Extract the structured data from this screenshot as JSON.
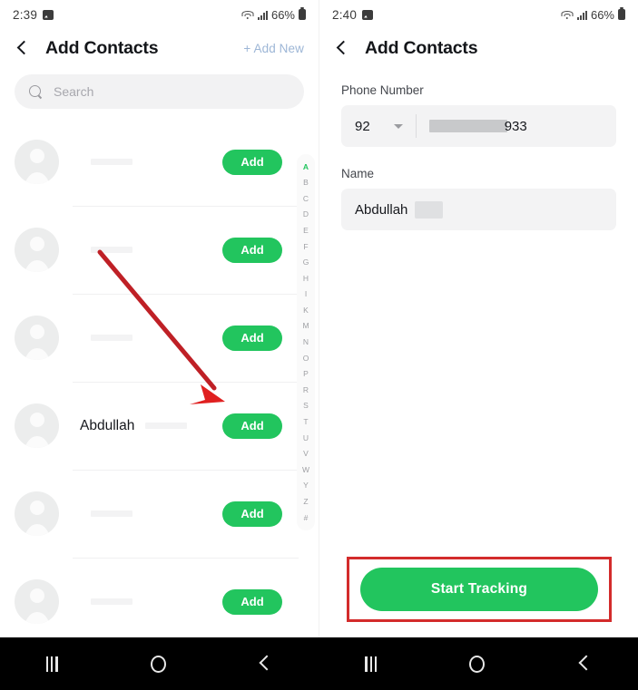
{
  "left_panel": {
    "status_bar": {
      "time": "2:39",
      "battery": "66%",
      "image_icon": "image-icon",
      "wifi_icon": "wifi-icon",
      "signal_icon": "signal-icon",
      "battery_icon": "battery-icon"
    },
    "appbar": {
      "back_icon": "back-chevron-icon",
      "title": "Add Contacts",
      "add_new_label": "+ Add New"
    },
    "search": {
      "icon": "search-icon",
      "placeholder": "Search",
      "value": ""
    },
    "contacts": [
      {
        "name": "",
        "add_label": "Add",
        "redacted": true
      },
      {
        "name": "",
        "add_label": "Add",
        "redacted": true
      },
      {
        "name": "",
        "add_label": "Add",
        "redacted": true
      },
      {
        "name": "Abdullah",
        "add_label": "Add",
        "redacted": true
      },
      {
        "name": "",
        "add_label": "Add",
        "redacted": true
      },
      {
        "name": "",
        "add_label": "Add",
        "redacted": true
      }
    ],
    "alpha_index": {
      "letters": [
        "A",
        "B",
        "C",
        "D",
        "E",
        "F",
        "G",
        "H",
        "I",
        "K",
        "M",
        "N",
        "O",
        "P",
        "R",
        "S",
        "T",
        "U",
        "V",
        "W",
        "Y",
        "Z",
        "#"
      ],
      "active": "A"
    },
    "annotation": {
      "type": "arrow",
      "color": "#bf2026",
      "points_to": "add-button-abdullah"
    }
  },
  "right_panel": {
    "status_bar": {
      "time": "2:40",
      "battery": "66%",
      "image_icon": "image-icon",
      "wifi_icon": "wifi-icon",
      "signal_icon": "signal-icon",
      "battery_icon": "battery-icon"
    },
    "appbar": {
      "back_icon": "back-chevron-icon",
      "title": "Add Contacts"
    },
    "form": {
      "phone_label": "Phone Number",
      "country_code": "92",
      "phone_visible_digits": "933",
      "phone_redacted": true,
      "name_label": "Name",
      "name_value": "Abdullah",
      "name_redacted": true
    },
    "primary_button": {
      "label": "Start Tracking"
    },
    "annotation": {
      "type": "rectangle",
      "color": "#d32b2b",
      "highlights": "start-tracking-button"
    }
  },
  "nav_bar": {
    "recents_icon": "recents-icon",
    "home_icon": "home-icon",
    "back_icon": "back-icon"
  },
  "colors": {
    "accent_green": "#22c55e",
    "annotation_red": "#d32b2b",
    "link_blue": "#9db6d6",
    "field_gray": "#f3f3f4"
  }
}
